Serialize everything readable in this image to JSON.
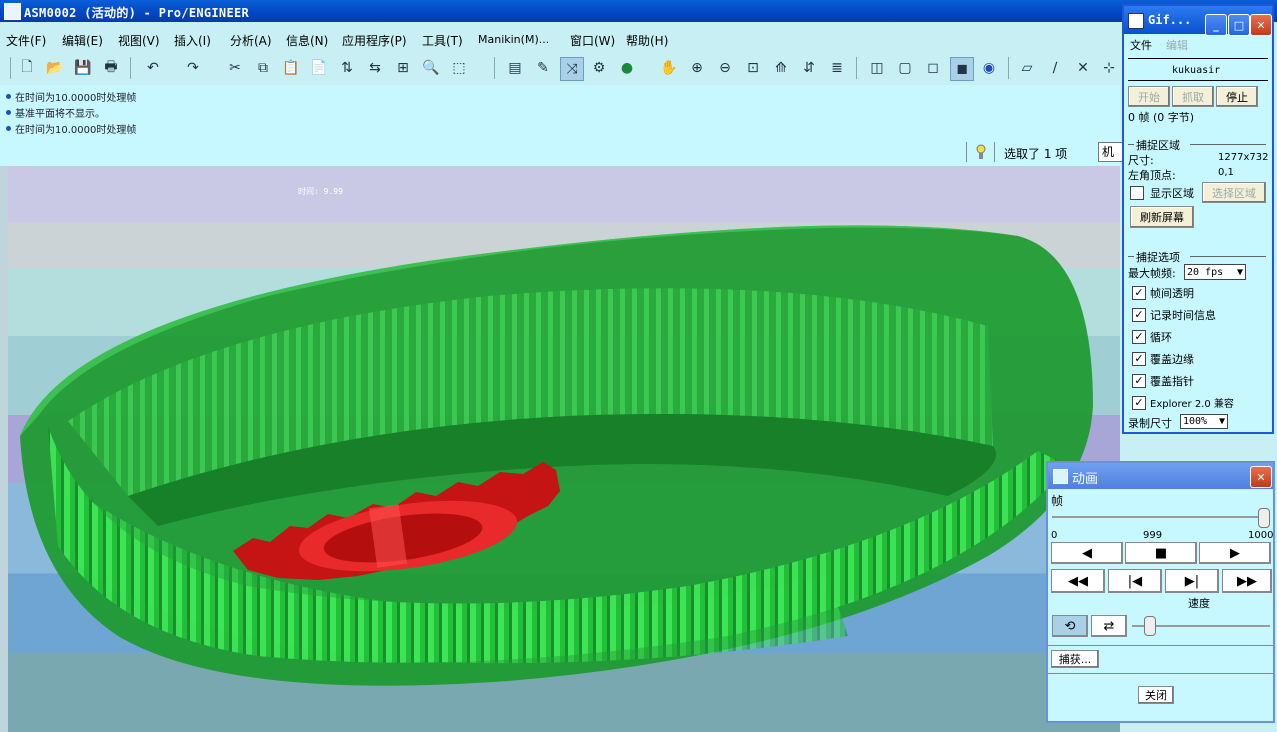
{
  "window": {
    "title": "ASM0002 (活动的) - Pro/ENGINEER"
  },
  "menu": [
    "文件(F)",
    "编辑(E)",
    "视图(V)",
    "插入(I)",
    "分析(A)",
    "信息(N)",
    "应用程序(P)",
    "工具(T)",
    "Manikin(M)...",
    "窗口(W)",
    "帮助(H)"
  ],
  "messages": [
    "在时间为10.0000时处理帧",
    "基准平面将不显示。",
    "在时间为10.0000时处理帧"
  ],
  "status": {
    "selection": "选取了 1 项",
    "filter": "机构"
  },
  "viewport": {
    "time_label": "时间: 9.99"
  },
  "gif_panel": {
    "title": "Gif...",
    "menu": [
      "文件",
      "编辑"
    ],
    "user": "kukuasir",
    "btn_start": "开始",
    "btn_grab": "抓取",
    "btn_stop": "停止",
    "frames": "0 帧 (0 字节)",
    "capture_area_group": "捕捉区域",
    "size_label": "尺寸:",
    "size_value": "1277x732",
    "corner_label": "左角顶点:",
    "corner_value": "0,1",
    "show_area": "显示区域",
    "btn_select_area": "选择区域",
    "btn_refresh": "刷新屏幕",
    "capture_opts_group": "捕捉选项",
    "max_fps_label": "最大帧频:",
    "max_fps_value": "20 fps",
    "options": [
      "帧间透明",
      "记录时间信息",
      "循环",
      "覆盖边缘",
      "覆盖指针",
      "Explorer 2.0 兼容"
    ],
    "rec_size_label": "录制尺寸",
    "rec_size_value": "100%"
  },
  "anim_panel": {
    "title": "动画",
    "frame_label": "帧",
    "min": "0",
    "current": "999",
    "max": "1000",
    "speed_label": "速度",
    "btn_capture": "捕获...",
    "btn_close": "关闭"
  },
  "colors": {
    "title_blue": "#0246c4",
    "panel_bg": "#c8f8ff",
    "gear_green": "#22c83c",
    "pinion_red": "#d01818"
  }
}
